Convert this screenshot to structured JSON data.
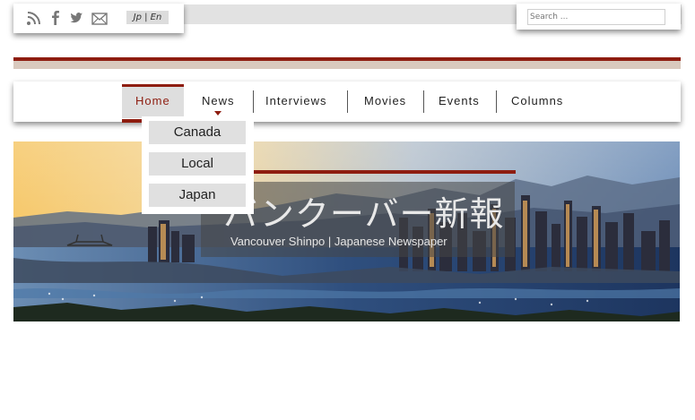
{
  "header": {
    "language_switch": "Jp | En",
    "search_placeholder": "Search ...",
    "social_icons": [
      "rss-icon",
      "facebook-icon",
      "twitter-icon",
      "mail-icon"
    ]
  },
  "nav": {
    "items": [
      "Home",
      "News",
      "Interviews",
      "Movies",
      "Events",
      "Columns"
    ],
    "active": "Home",
    "dropdown": [
      "Canada",
      "Local",
      "Japan"
    ]
  },
  "hero": {
    "title": "バンクーバー新報",
    "subtitle": "Vancouver Shinpo | Japanese Newspaper"
  },
  "colors": {
    "accent": "#8e1d10",
    "rule_beige": "#d9c9be",
    "nav_active_bg": "#dedede"
  }
}
